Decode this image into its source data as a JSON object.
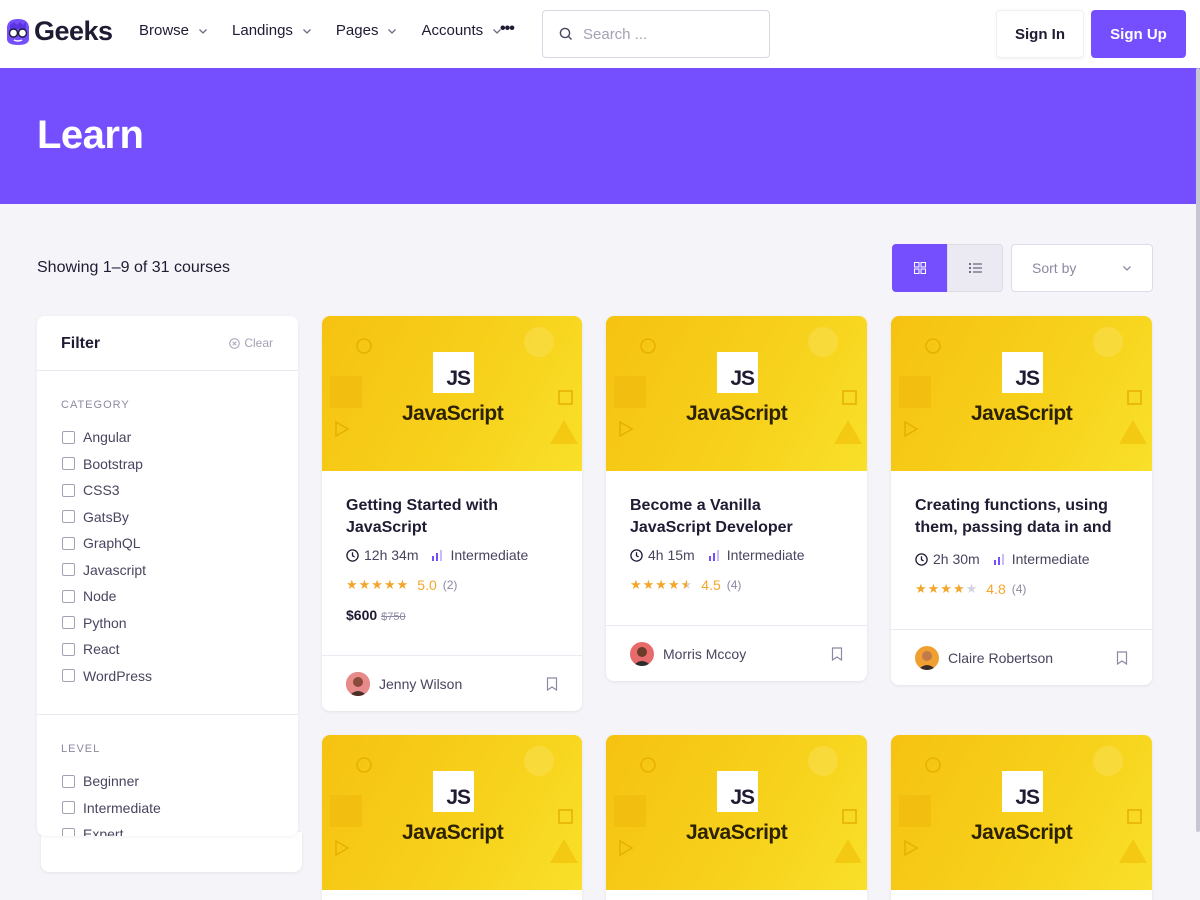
{
  "brand": {
    "name": "Geeks"
  },
  "nav": {
    "items": [
      {
        "label": "Browse"
      },
      {
        "label": "Landings"
      },
      {
        "label": "Pages"
      },
      {
        "label": "Accounts"
      }
    ],
    "more": "•••"
  },
  "search": {
    "placeholder": "Search ...",
    "value": ""
  },
  "auth": {
    "signin": "Sign In",
    "signup": "Sign Up"
  },
  "hero": {
    "title": "Learn"
  },
  "toolbar": {
    "showing": "Showing 1–9 of 31 courses",
    "sort_label": "Sort by",
    "active_view": "grid"
  },
  "filter": {
    "title": "Filter",
    "clear": "Clear",
    "category_label": "CATEGORY",
    "categories": [
      "Angular",
      "Bootstrap",
      "CSS3",
      "GatsBy",
      "GraphQL",
      "Javascript",
      "Node",
      "Python",
      "React",
      "WordPress"
    ],
    "level_label": "LEVEL",
    "levels": [
      "Beginner",
      "Intermediate",
      "Expert"
    ]
  },
  "courses": [
    {
      "image_text": "JavaScript",
      "image_badge": "JS",
      "title": "Getting Started with JavaScript",
      "duration": "12h 34m",
      "level": "Intermediate",
      "rating": "5.0",
      "stars": 5,
      "reviews": "(2)",
      "price": "$600",
      "old_price": "$750",
      "author": "Jenny Wilson"
    },
    {
      "image_text": "JavaScript",
      "image_badge": "JS",
      "title": "Become a Vanilla JavaScript Developer",
      "duration": "4h 15m",
      "level": "Intermediate",
      "rating": "4.5",
      "stars": 4.5,
      "reviews": "(4)",
      "author": "Morris Mccoy"
    },
    {
      "image_text": "JavaScript",
      "image_badge": "JS",
      "title": "Creating functions, using them, passing data in and",
      "duration": "2h 30m",
      "level": "Intermediate",
      "rating": "4.8",
      "stars": 4,
      "reviews": "(4)",
      "author": "Claire Robertson"
    },
    {
      "image_text": "JavaScript",
      "image_badge": "JS"
    },
    {
      "image_text": "JavaScript",
      "image_badge": "JS"
    },
    {
      "image_text": "JavaScript",
      "image_badge": "JS"
    }
  ],
  "colors": {
    "primary": "#754ffe",
    "star": "#f4a62a",
    "course_image": "#f7d21c"
  },
  "icons": [
    "geeks-logo-icon",
    "chevron-down-icon",
    "more-dots-icon",
    "search-icon",
    "grid-view-icon",
    "list-view-icon",
    "clear-icon",
    "clock-icon",
    "level-bars-icon",
    "bookmark-icon"
  ]
}
